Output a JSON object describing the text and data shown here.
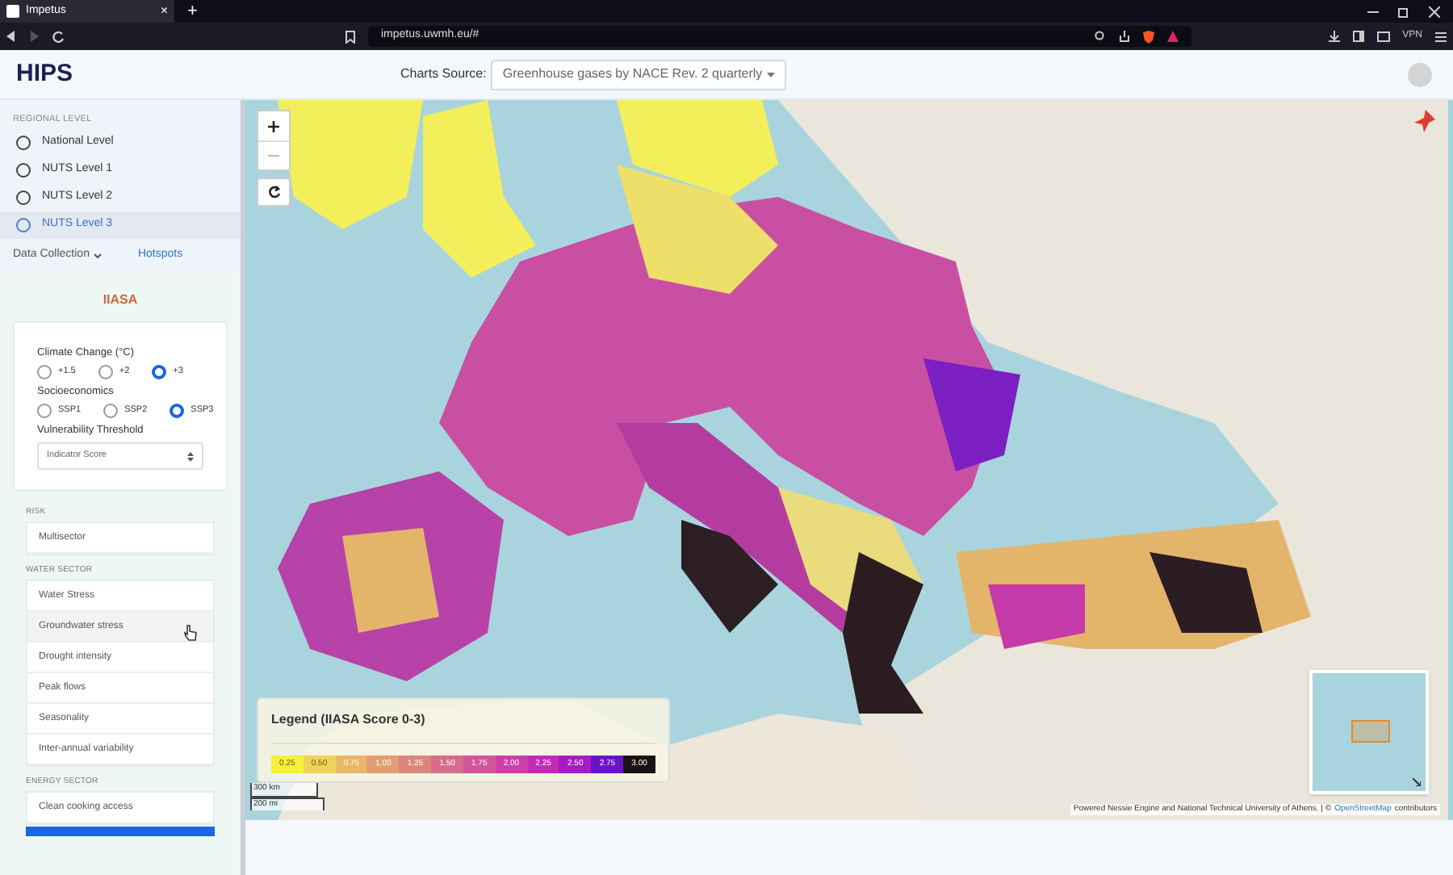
{
  "browser": {
    "tab_title": "Impetus",
    "tab_close": "×",
    "new_tab": "+",
    "url": "impetus.uwmh.eu/#",
    "vpn": "VPN"
  },
  "header": {
    "logo": "HIPS",
    "charts_source_label": "Charts Source:",
    "charts_source_value": "Greenhouse gases by NACE Rev. 2 quarterly"
  },
  "regional_level": {
    "heading": "REGIONAL LEVEL",
    "options": [
      {
        "label": "National Level",
        "selected": false
      },
      {
        "label": "NUTS Level 1",
        "selected": false
      },
      {
        "label": "NUTS Level 2",
        "selected": false
      },
      {
        "label": "NUTS Level 3",
        "selected": true
      }
    ]
  },
  "nav_tabs": [
    {
      "label": "Data Collection",
      "dropdown": true
    },
    {
      "label": "Hotspots",
      "dropdown": false
    }
  ],
  "panel": {
    "title": "IIASA",
    "climate_change": {
      "label": "Climate Change (°C)",
      "options": [
        {
          "label": "+1.5",
          "selected": false
        },
        {
          "label": "+2",
          "selected": false
        },
        {
          "label": "+3",
          "selected": true
        }
      ]
    },
    "socioeconomics": {
      "label": "Socioeconomics",
      "options": [
        {
          "label": "SSP1",
          "selected": false
        },
        {
          "label": "SSP2",
          "selected": false
        },
        {
          "label": "SSP3",
          "selected": true
        }
      ]
    },
    "threshold": {
      "label": "Vulnerability Threshold",
      "value": "Indicator Score"
    }
  },
  "sectors": [
    {
      "heading": "RISK",
      "items": [
        {
          "label": "Multisector",
          "hovered": false
        }
      ]
    },
    {
      "heading": "WATER SECTOR",
      "items": [
        {
          "label": "Water Stress",
          "hovered": false
        },
        {
          "label": "Groundwater stress",
          "hovered": true
        },
        {
          "label": "Drought intensity",
          "hovered": false
        },
        {
          "label": "Peak flows",
          "hovered": false
        },
        {
          "label": "Seasonality",
          "hovered": false
        },
        {
          "label": "Inter-annual variability",
          "hovered": false
        }
      ]
    },
    {
      "heading": "ENERGY SECTOR",
      "items": [
        {
          "label": "Clean cooking access",
          "hovered": false
        }
      ]
    }
  ],
  "map": {
    "legend": {
      "title": "Legend (IIASA Score 0-3)",
      "bins": [
        {
          "label": "0.25",
          "color": "#f5ef3e"
        },
        {
          "label": "0.50",
          "color": "#eed35c"
        },
        {
          "label": "0.75",
          "color": "#e8b868"
        },
        {
          "label": "1.00",
          "color": "#e29e72"
        },
        {
          "label": "1.25",
          "color": "#dc857d"
        },
        {
          "label": "1.50",
          "color": "#d76c8b"
        },
        {
          "label": "1.75",
          "color": "#d2559a"
        },
        {
          "label": "2.00",
          "color": "#cc3fa9"
        },
        {
          "label": "2.25",
          "color": "#c02cb6"
        },
        {
          "label": "2.50",
          "color": "#a61dbf"
        },
        {
          "label": "2.75",
          "color": "#6a14c9"
        },
        {
          "label": "3.00",
          "color": "#1c1212"
        }
      ]
    },
    "scale": [
      "300 km",
      "200 mi"
    ],
    "attribution": "Powered Nessie Engine and National Technical University of Athens. | ©",
    "attribution_link": "OpenStreetMap",
    "attribution_tail": "contributors"
  }
}
